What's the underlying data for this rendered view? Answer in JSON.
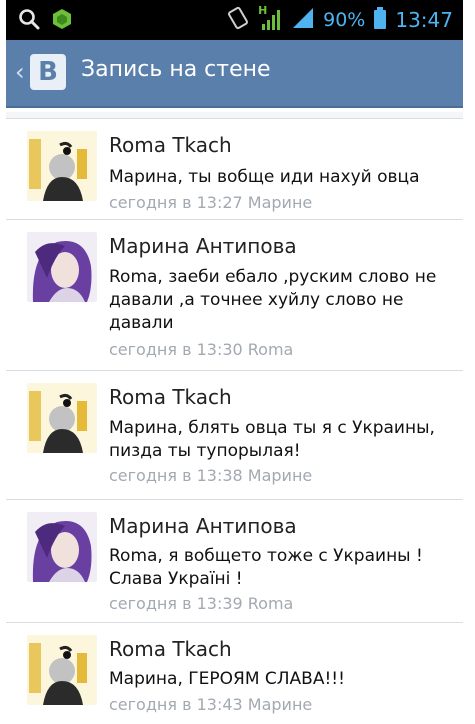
{
  "status_bar": {
    "network_type": "H",
    "battery_percent": "90%",
    "time": "13:47",
    "icons": [
      "search-icon",
      "app-notification-icon",
      "rotation-lock-icon",
      "signal-icon",
      "battery-icon"
    ]
  },
  "header": {
    "back_icon": "chevron-left-icon",
    "logo_letter": "B",
    "title": "Запись на стене"
  },
  "comments": [
    {
      "author": "Roma Tkach",
      "text": "Марина, ты вобще иди нахуй овца",
      "meta": "сегодня в 13:27 Марине",
      "avatar": "roma"
    },
    {
      "author": "Марина Антипова",
      "text": "Roma, заеби ебало ,руским слово не давали ,а точнее хуйлу слово не давали",
      "meta": "сегодня в 13:30 Roma",
      "avatar": "marina"
    },
    {
      "author": "Roma Tkach",
      "text": "Марина, блять овца ты я с Украины, пизда ты тупорылая!",
      "meta": "сегодня в 13:38 Марине",
      "avatar": "roma"
    },
    {
      "author": "Марина Антипова",
      "text": "Roma, я вобщето тоже с Украины !Слава Україні !",
      "meta": "сегодня в 13:39 Roma",
      "avatar": "marina"
    },
    {
      "author": "Roma Tkach",
      "text": "Марина, ГЕРОЯМ СЛАВА!!!",
      "meta": "сегодня в 13:43 Марине",
      "avatar": "roma"
    }
  ],
  "colors": {
    "header_bg": "#5a7faa",
    "status_accent": "#4fb3f0",
    "meta_text": "#a3a9b1"
  }
}
